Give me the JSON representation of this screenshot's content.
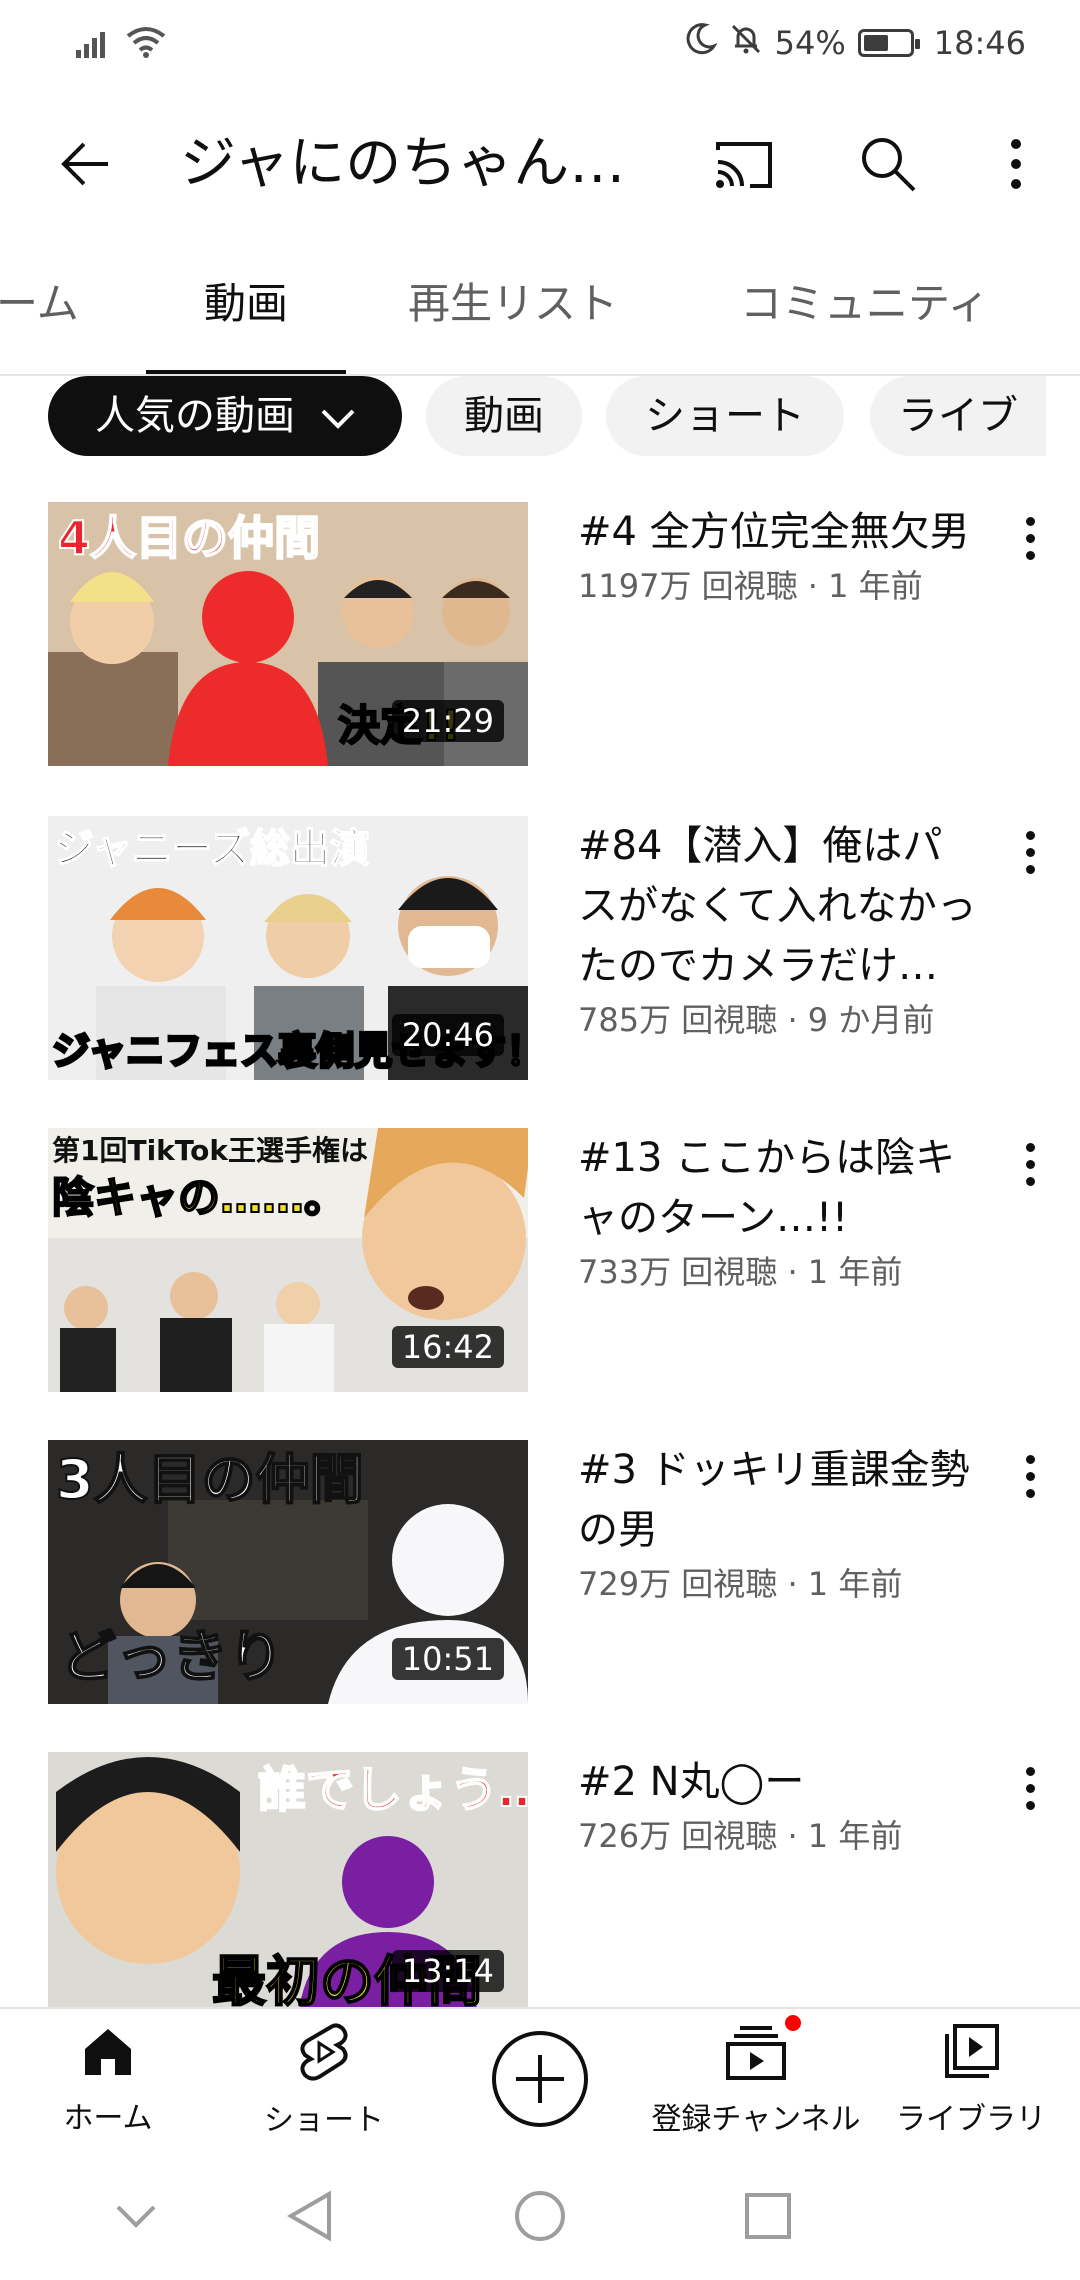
{
  "status_bar": {
    "battery_text": "54%",
    "battery_level": 0.54,
    "time": "18:46"
  },
  "app_bar": {
    "title": "ジャにのちゃん…",
    "icons": [
      "back-arrow-icon",
      "cast-icon",
      "search-icon",
      "more-vert-icon"
    ]
  },
  "tabs": [
    {
      "label": "ーム",
      "active": false
    },
    {
      "label": "動画",
      "active": true
    },
    {
      "label": "再生リスト",
      "active": false
    },
    {
      "label": "コミュニティ",
      "active": false
    }
  ],
  "chips": [
    {
      "label": "人気の動画",
      "active": true
    },
    {
      "label": "動画",
      "active": false
    },
    {
      "label": "ショート",
      "active": false
    },
    {
      "label": "ライブ",
      "active": false
    }
  ],
  "videos": [
    {
      "title": "#4 全方位完全無欠男",
      "views": "1197万 回視聴",
      "age": "1 年前",
      "duration": "21:29"
    },
    {
      "title": "#84【潜入】俺はパスがなくて入れなかったのでカメラだけ…",
      "views": "785万 回視聴",
      "age": "9 か月前",
      "duration": "20:46"
    },
    {
      "title": "#13 ここからは陰キャのターン…!!",
      "views": "733万 回視聴",
      "age": "1 年前",
      "duration": "16:42"
    },
    {
      "title": "#3 ドッキリ重課金勢の男",
      "views": "729万 回視聴",
      "age": "1 年前",
      "duration": "10:51"
    },
    {
      "title": "#2 N丸◯ー",
      "views": "726万 回視聴",
      "age": "1 年前",
      "duration": "13:14"
    }
  ],
  "thumb_texts": {
    "v1": "4人目の仲間",
    "v1b": "決定!!",
    "v2": "ジャニーズ総出演",
    "v2b": "ジャニフェス裏側見せます！",
    "v3a": "第1回TikTok王選手権は",
    "v3b": "陰キャの……。",
    "v4a": "3人目の仲間",
    "v4b": "どっきり",
    "v5a": "誰でしょう…?",
    "v5b": "最初の仲間"
  },
  "bottom_nav": [
    {
      "label": "ホーム",
      "icon": "home-icon",
      "active": true
    },
    {
      "label": "ショート",
      "icon": "shorts-icon",
      "active": false
    },
    {
      "label": "",
      "icon": "create-plus-icon",
      "active": false
    },
    {
      "label": "登録チャンネル",
      "icon": "subscriptions-icon",
      "active": false,
      "badge": true
    },
    {
      "label": "ライブラリ",
      "icon": "library-icon",
      "active": false
    }
  ],
  "colors": {
    "accent_red": "#ff0000",
    "text_primary": "#0f0f0f",
    "text_secondary": "#606060",
    "chip_bg": "#f2f2f2"
  }
}
